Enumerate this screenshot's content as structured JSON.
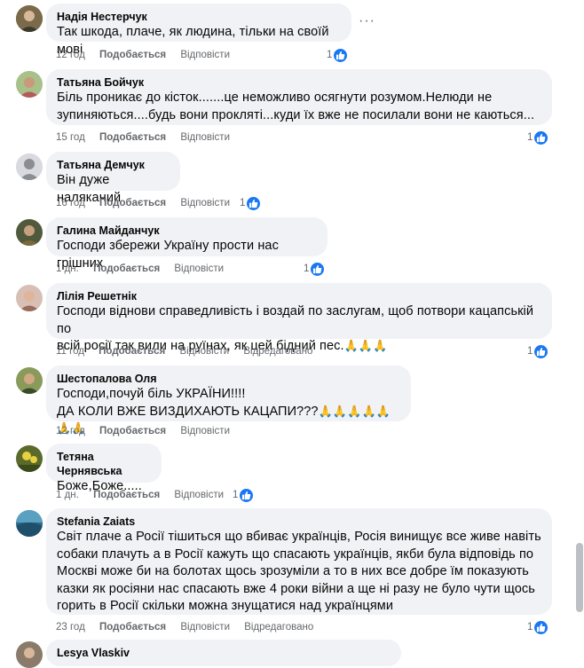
{
  "comments": [
    {
      "author": "Надія Нестерчук",
      "lines": [
        "Так шкода, плаче, як людина, тільки на своїй мові"
      ],
      "time": "12 год",
      "like_label": "Подобається",
      "reply_label": "Відповісти",
      "edited": "",
      "count": "1",
      "avatar_color": "#6b5a3a"
    },
    {
      "author": "Татьяна Бойчук",
      "lines": [
        "Біль проникає до кісток.......це неможливо осягнути розумом.Нелюди не",
        "зупиняються....будь вони прокляті...куди їх вже не посилали вони не каються..."
      ],
      "time": "15 год",
      "like_label": "Подобається",
      "reply_label": "Відповісти",
      "edited": "",
      "count": "1",
      "avatar_color": "#9bb37a"
    },
    {
      "author": "Татьяна Демчук",
      "lines": [
        "Він дуже наляканий"
      ],
      "time": "16 год",
      "like_label": "Подобається",
      "reply_label": "Відповісти",
      "edited": "",
      "count": "1",
      "avatar_color": "#bcc0c4"
    },
    {
      "author": "Галина Майданчук",
      "lines": [
        "Господи збережи Україну прости нас грішних"
      ],
      "time": "1 дн.",
      "like_label": "Подобається",
      "reply_label": "Відповісти",
      "edited": "",
      "count": "1",
      "avatar_color": "#4f5a3c"
    },
    {
      "author": "Лілія Решетнік",
      "lines": [
        "Господи віднови справедливість і воздай по заслугам, щоб потвори кацапській по",
        "всій росії так вили на руїнах, як цей бідний пес."
      ],
      "emoji_suffix": "🙏🙏🙏",
      "time": "11 год",
      "like_label": "Подобається",
      "reply_label": "Відповісти",
      "edited": "Відредаговано",
      "count": "1",
      "avatar_color": "#b7948a"
    },
    {
      "author": "Шестопалова Оля",
      "lines": [
        "Господи,почуй біль УКРАЇНИ!!!!",
        "ДА КОЛИ ВЖЕ ВИЗДИХАЮТЬ КАЦАПИ???"
      ],
      "emoji_suffix": "🙏🙏🙏🙏🙏🙏🙏",
      "time": "12 год",
      "like_label": "Подобається",
      "reply_label": "Відповісти",
      "edited": "",
      "count": "",
      "avatar_color": "#6f7a4d"
    },
    {
      "author": "Тетяна Чернявська",
      "lines": [
        "Боже,Боже....."
      ],
      "time": "1 дн.",
      "like_label": "Подобається",
      "reply_label": "Відповісти",
      "edited": "",
      "count": "1",
      "avatar_color": "#7d8a3a"
    },
    {
      "author": "Stefania Zaiats",
      "lines": [
        "Світ плаче а Росії тішиться що вбиває українців, Росія винищує все живе навіть",
        "собаки плачуть а в Росії кажуть що спасають українців, якби була відповідь по",
        "Москві може би на болотах щось зрозуміли а то в них все добре їм показують",
        "казки як росіяни нас спасають вже 4 роки війни а ще ні разу не було чути щось",
        "горить в Росії скільки можна знущатися над українцями"
      ],
      "time": "23 год",
      "like_label": "Подобається",
      "reply_label": "Відповісти",
      "edited": "Відредаговано",
      "count": "1",
      "avatar_color": "#3d7f9a"
    },
    {
      "author": "Lesya Vlaskiv",
      "lines": [],
      "time": "",
      "like_label": "",
      "reply_label": "",
      "edited": "",
      "count": "",
      "avatar_color": "#8a7a6a"
    }
  ],
  "more_options_icon": "ellipsis-icon",
  "like_icon": "thumbs-up-icon"
}
